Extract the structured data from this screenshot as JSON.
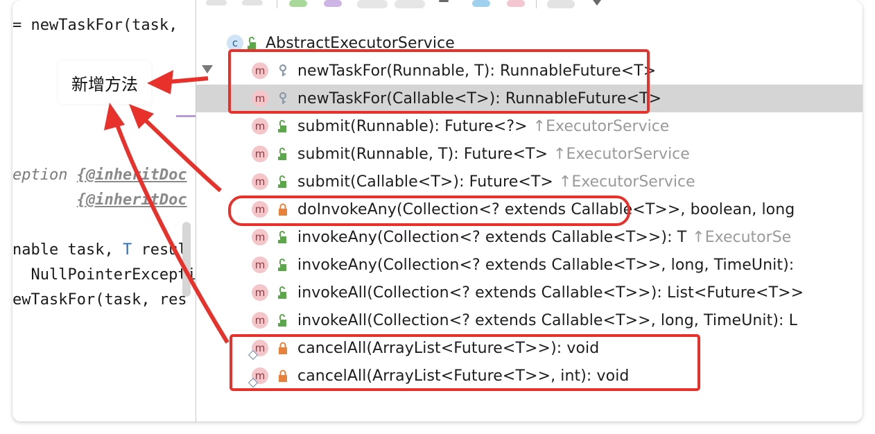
{
  "editor": {
    "lines": [
      {
        "text": "= newTaskFor(task,",
        "style": "code"
      },
      {
        "text": "eption ",
        "tag": "{@inheritDoc",
        "style": "doc"
      },
      {
        "text": "       ",
        "tag": "{@inheritDoc",
        "style": "doc"
      },
      {
        "pre": "nable task, ",
        "tparam": "T",
        "post": " resul",
        "style": "code"
      },
      {
        "text": "  NullPointerExcepti",
        "style": "code"
      },
      {
        "text": "ewTaskFor(task, res",
        "style": "code"
      }
    ]
  },
  "annotation": {
    "label": "新增方法",
    "color": "#e8312a"
  },
  "structure": {
    "class_name": "AbstractExecutorService",
    "class_badge": "c",
    "method_badge": "m",
    "rows": [
      {
        "sig": "newTaskFor(Runnable, T): RunnableFuture<T>",
        "inherited": "",
        "visibility": "protected",
        "icon": "key-icon"
      },
      {
        "sig": "newTaskFor(Callable<T>): RunnableFuture<T>",
        "inherited": "",
        "visibility": "protected",
        "icon": "key-icon",
        "selected": true
      },
      {
        "sig": "submit(Runnable): Future<?>",
        "inherited": "↑ExecutorService",
        "visibility": "public",
        "icon": "unlock-icon"
      },
      {
        "sig": "submit(Runnable, T): Future<T>",
        "inherited": "↑ExecutorService",
        "visibility": "public",
        "icon": "unlock-icon"
      },
      {
        "sig": "submit(Callable<T>): Future<T>",
        "inherited": "↑ExecutorService",
        "visibility": "public",
        "icon": "unlock-icon"
      },
      {
        "sig": "doInvokeAny(Collection<? extends Callable<T>>, boolean, long",
        "inherited": "",
        "visibility": "private",
        "icon": "lock-icon"
      },
      {
        "sig": "invokeAny(Collection<? extends Callable<T>>): T",
        "inherited": "↑ExecutorSe",
        "visibility": "public",
        "icon": "unlock-icon"
      },
      {
        "sig": "invokeAny(Collection<? extends Callable<T>>, long, TimeUnit):",
        "inherited": "",
        "visibility": "public",
        "icon": "unlock-icon"
      },
      {
        "sig": "invokeAll(Collection<? extends Callable<T>>): List<Future<T>>",
        "inherited": "",
        "visibility": "public",
        "icon": "unlock-icon"
      },
      {
        "sig": "invokeAll(Collection<? extends Callable<T>>, long, TimeUnit): L",
        "inherited": "",
        "visibility": "public",
        "icon": "unlock-icon"
      },
      {
        "sig": "cancelAll(ArrayList<Future<T>>): void",
        "inherited": "",
        "visibility": "private",
        "icon": "lock-icon",
        "static": true
      },
      {
        "sig": "cancelAll(ArrayList<Future<T>>, int): void",
        "inherited": "",
        "visibility": "private",
        "icon": "lock-icon",
        "static": true
      }
    ]
  },
  "colors": {
    "highlight": "#e8312a",
    "selected_row": "#d5d5d5",
    "method_badge": "#f4c6c9",
    "public_icon": "#5aa84a",
    "private_icon": "#e8823a",
    "protected_icon": "#8a9aa8"
  }
}
